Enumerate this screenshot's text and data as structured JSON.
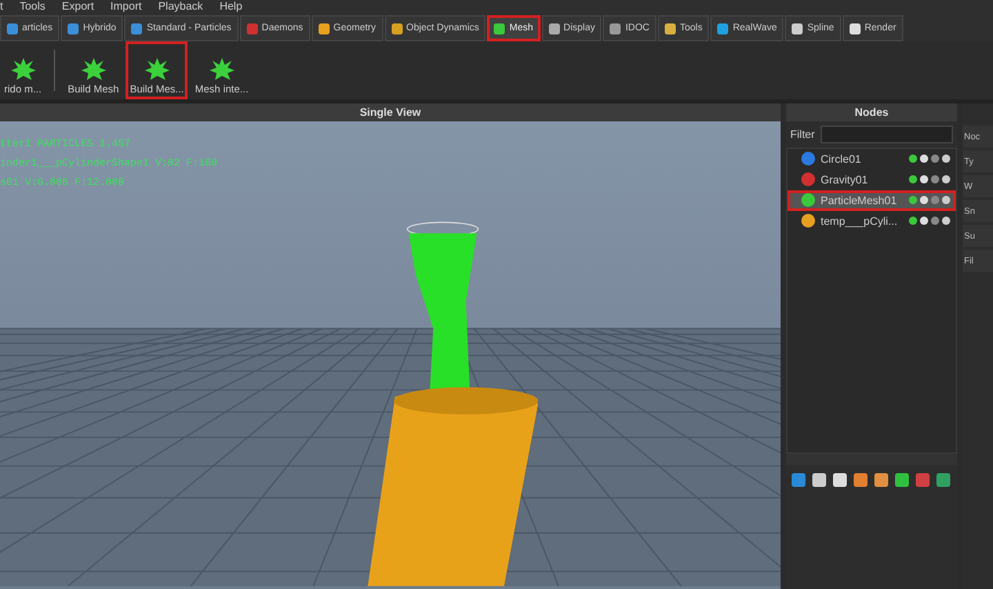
{
  "menu": [
    "t",
    "Tools",
    "Export",
    "Import",
    "Playback",
    "Help"
  ],
  "tabs": [
    {
      "label": "articles",
      "selected": false,
      "highlighted": false
    },
    {
      "label": "Hybrido",
      "selected": false,
      "highlighted": false
    },
    {
      "label": "Standard - Particles",
      "selected": false,
      "highlighted": false
    },
    {
      "label": "Daemons",
      "selected": false,
      "highlighted": false
    },
    {
      "label": "Geometry",
      "selected": false,
      "highlighted": false
    },
    {
      "label": "Object Dynamics",
      "selected": false,
      "highlighted": false
    },
    {
      "label": "Mesh",
      "selected": true,
      "highlighted": true
    },
    {
      "label": "Display",
      "selected": false,
      "highlighted": false
    },
    {
      "label": "IDOC",
      "selected": false,
      "highlighted": false
    },
    {
      "label": "Tools",
      "selected": false,
      "highlighted": false
    },
    {
      "label": "RealWave",
      "selected": false,
      "highlighted": false
    },
    {
      "label": "Spline",
      "selected": false,
      "highlighted": false
    },
    {
      "label": "Render",
      "selected": false,
      "highlighted": false
    }
  ],
  "toolbar": [
    {
      "label": "rido m...",
      "highlighted": false
    },
    {
      "label": "Build Mesh",
      "highlighted": false
    },
    {
      "label": "Build Mes...",
      "highlighted": true
    },
    {
      "label": "Mesh inte...",
      "highlighted": false
    }
  ],
  "viewport": {
    "title": "Single View",
    "overlay": [
      "tter1 PARTICLES 1.457",
      "inder1___pCylinderShape1 V:82 F:160",
      "s01 V:6.006 F:12.000"
    ]
  },
  "nodes": {
    "title": "Nodes",
    "filter_label": "Filter",
    "items": [
      {
        "name": "Circle01",
        "selected": false,
        "highlighted": false
      },
      {
        "name": "Gravity01",
        "selected": false,
        "highlighted": false
      },
      {
        "name": "ParticleMesh01",
        "selected": true,
        "highlighted": true
      },
      {
        "name": "temp___pCyli...",
        "selected": false,
        "highlighted": false
      }
    ]
  },
  "properties": {
    "rows": [
      "Noc",
      "Ty",
      "W",
      "Sn",
      "Su",
      "Fil"
    ]
  }
}
